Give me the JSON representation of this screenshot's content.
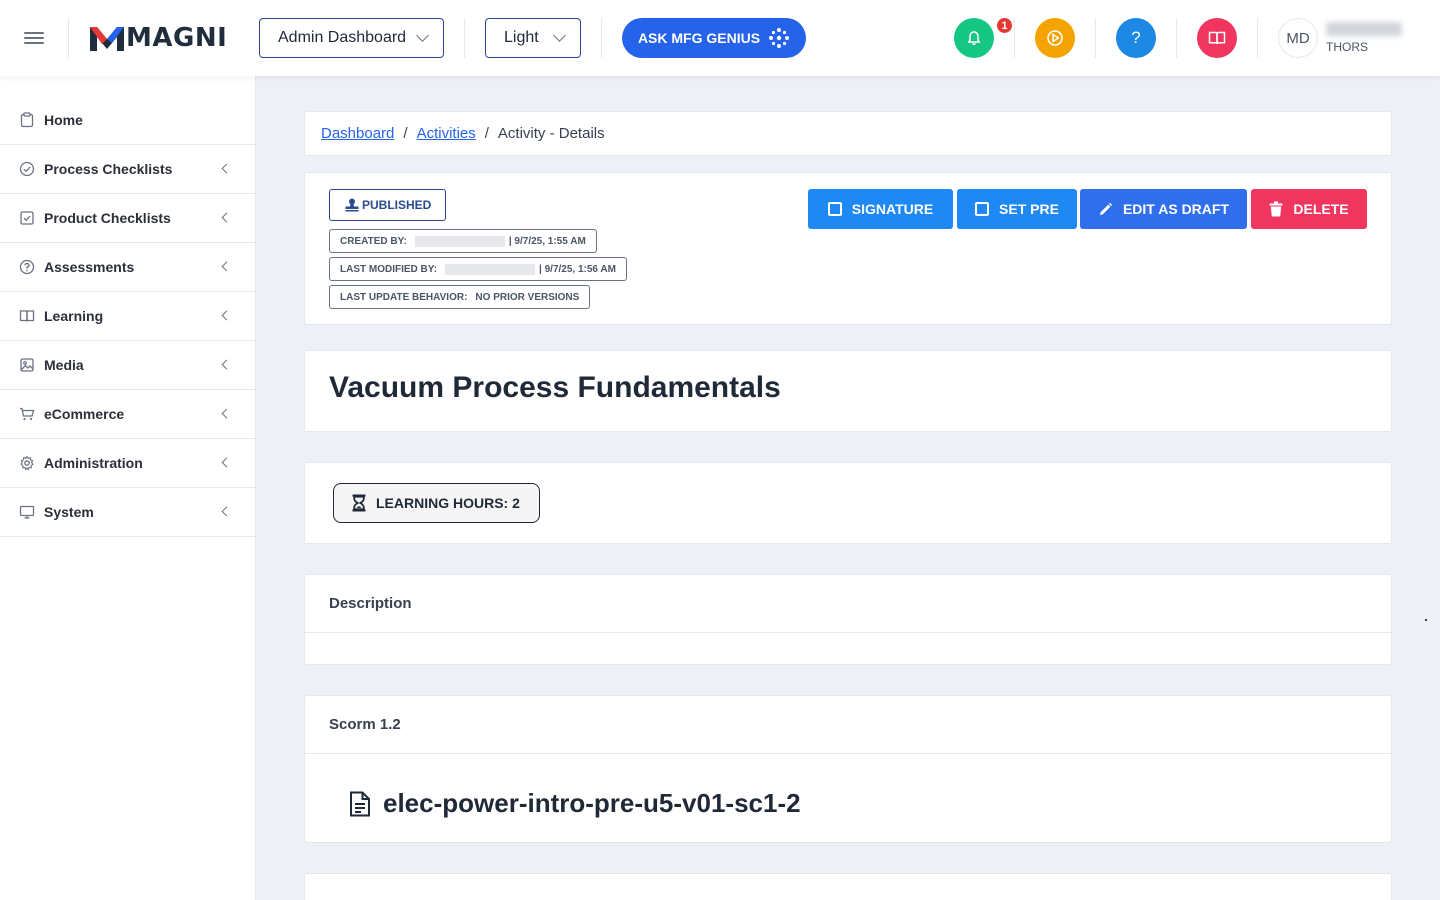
{
  "header": {
    "logo_text": "MAGNI",
    "dashboard_select": "Admin Dashboard",
    "theme_select": "Light",
    "ask_button": "ASK MFG GENIUS",
    "notification_count": "1",
    "avatar_initials": "MD",
    "user_org": "THORS",
    "colors": {
      "bell": "#16c784",
      "play": "#f5a300",
      "help": "#1e88e5",
      "book": "#f0355f",
      "ask": "#2563eb"
    }
  },
  "sidebar": {
    "items": [
      {
        "label": "Home",
        "icon": "clipboard-icon",
        "has_arrow": false
      },
      {
        "label": "Process Checklists",
        "icon": "check-circle-icon",
        "has_arrow": true
      },
      {
        "label": "Product Checklists",
        "icon": "check-square-icon",
        "has_arrow": true
      },
      {
        "label": "Assessments",
        "icon": "question-circle-icon",
        "has_arrow": true
      },
      {
        "label": "Learning",
        "icon": "book-icon",
        "has_arrow": true
      },
      {
        "label": "Media",
        "icon": "image-icon",
        "has_arrow": true
      },
      {
        "label": "eCommerce",
        "icon": "cart-icon",
        "has_arrow": true
      },
      {
        "label": "Administration",
        "icon": "gear-icon",
        "has_arrow": true
      },
      {
        "label": "System",
        "icon": "monitor-icon",
        "has_arrow": true
      }
    ]
  },
  "breadcrumb": {
    "items": [
      "Dashboard",
      "Activities",
      "Activity - Details"
    ],
    "separator": "/"
  },
  "status": {
    "published_label": "PUBLISHED",
    "created_label": "CREATED BY:",
    "created_value": "| 9/7/25, 1:55 AM",
    "modified_label": "LAST MODIFIED BY:",
    "modified_value": "| 9/7/25, 1:56 AM",
    "behavior_label": "LAST UPDATE BEHAVIOR:",
    "behavior_value": "NO PRIOR VERSIONS"
  },
  "actions": {
    "signature": "SIGNATURE",
    "set_pre": "SET PRE",
    "edit_draft": "EDIT AS DRAFT",
    "delete": "DELETE",
    "colors": {
      "signature": "#1e88f5",
      "set_pre": "#1e88f5",
      "edit_draft": "#2f6fec",
      "delete": "#f0355f"
    }
  },
  "activity": {
    "title": "Vacuum Process Fundamentals",
    "learning_hours": "LEARNING HOURS: 2",
    "description_label": "Description",
    "scorm_label": "Scorm 1.2",
    "scorm_file": "elec-power-intro-pre-u5-v01-sc1-2"
  }
}
